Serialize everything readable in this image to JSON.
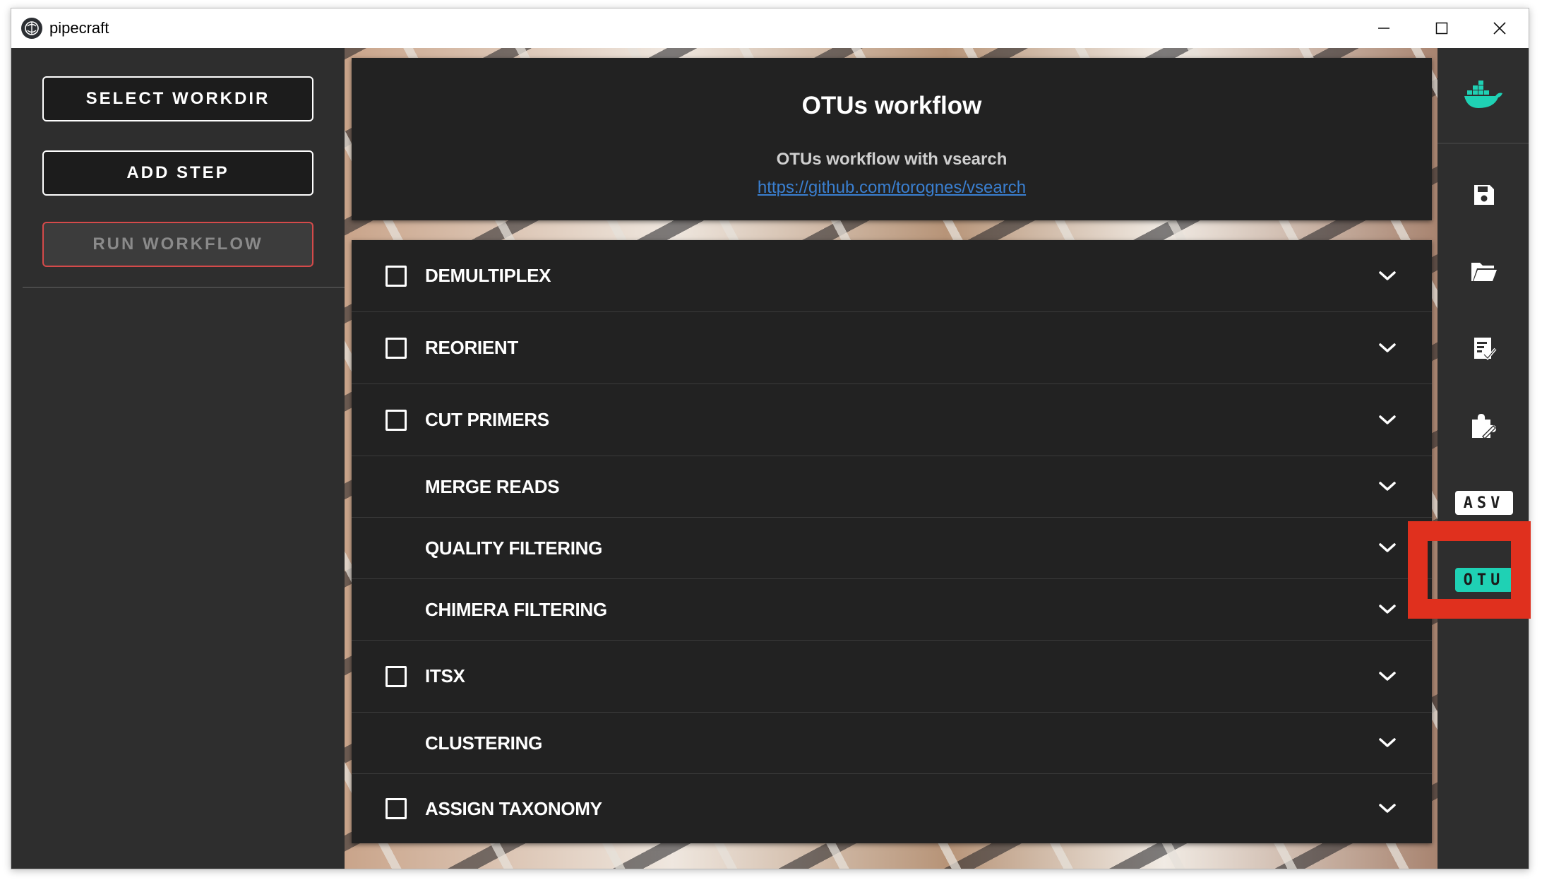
{
  "window": {
    "title": "pipecraft",
    "controls": [
      "minimize",
      "maximize",
      "close"
    ]
  },
  "left_panel": {
    "select_workdir": "SELECT WORKDIR",
    "add_step": "ADD STEP",
    "run_workflow": "RUN WORKFLOW"
  },
  "header": {
    "title": "OTUs workflow",
    "description": "OTUs workflow with vsearch",
    "link": "https://github.com/torognes/vsearch"
  },
  "steps": [
    {
      "label": "DEMULTIPLEX",
      "has_checkbox": true,
      "checked": false
    },
    {
      "label": "REORIENT",
      "has_checkbox": true,
      "checked": false
    },
    {
      "label": "CUT PRIMERS",
      "has_checkbox": true,
      "checked": false
    },
    {
      "label": "MERGE READS",
      "has_checkbox": false
    },
    {
      "label": "QUALITY FILTERING",
      "has_checkbox": false
    },
    {
      "label": "CHIMERA FILTERING",
      "has_checkbox": false
    },
    {
      "label": "ITSX",
      "has_checkbox": true,
      "checked": false
    },
    {
      "label": "CLUSTERING",
      "has_checkbox": false
    },
    {
      "label": "ASSIGN TAXONOMY",
      "has_checkbox": true,
      "checked": false
    }
  ],
  "right_sidebar": {
    "items": [
      "docker-icon",
      "save-icon",
      "folder-open-icon",
      "checklist-icon",
      "puzzle-icon"
    ],
    "asv_tag": "ASV",
    "otu_tag": "OTU"
  },
  "colors": {
    "accent_teal": "#1fd1b4",
    "highlight_red": "#e0301e",
    "link_blue": "#3a7fd0",
    "panel_dark": "#222222"
  }
}
